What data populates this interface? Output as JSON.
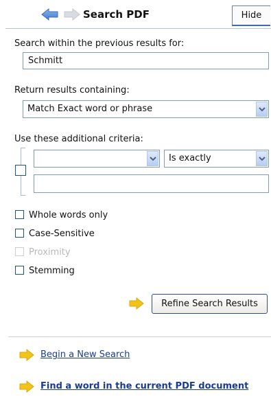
{
  "header": {
    "title": "Search PDF",
    "hide_label": "Hide",
    "back_icon": "back-arrow-icon",
    "forward_icon": "forward-arrow-icon"
  },
  "previous_results": {
    "label": "Search within the previous results for:",
    "value": "Schmitt"
  },
  "return_results": {
    "label": "Return results containing:",
    "selected": "Match Exact word or phrase"
  },
  "criteria": {
    "label": "Use these additional criteria:",
    "field_selected": "",
    "operator_selected": "Is exactly",
    "value": ""
  },
  "options": {
    "whole_words": "Whole words only",
    "case_sensitive": "Case-Sensitive",
    "proximity": "Proximity",
    "stemming": "Stemming"
  },
  "refine_button": "Refine Search Results",
  "links": {
    "new_search": "Begin a New Search",
    "find_word": "Find a word in the current PDF document"
  },
  "colors": {
    "accent_blue": "#3c6bb0",
    "arrow_yellow": "#f2c318",
    "link_blue": "#1a3b95"
  }
}
